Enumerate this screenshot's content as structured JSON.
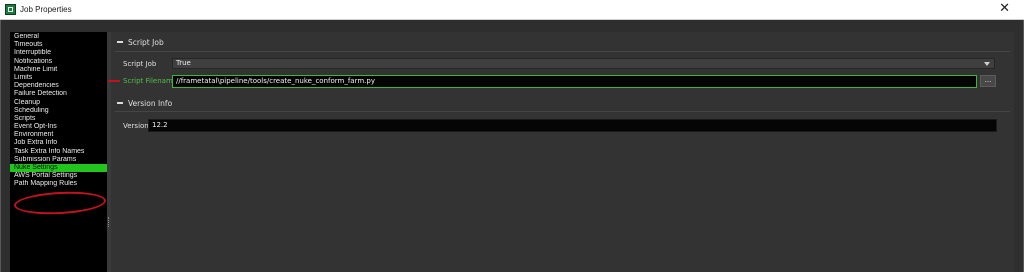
{
  "window": {
    "title": "Job Properties",
    "close_glyph": "✕"
  },
  "sidebar": {
    "items": [
      "General",
      "Timeouts",
      "Interruptible",
      "Notifications",
      "Machine Limit",
      "Limits",
      "Dependencies",
      "Failure Detection",
      "Cleanup",
      "Scheduling",
      "Scripts",
      "Event Opt-Ins",
      "Environment",
      "Job Extra Info",
      "Task Extra Info Names",
      "Submission Params",
      "Nuke Settings",
      "AWS Portal Settings",
      "Path Mapping Rules"
    ],
    "selected": "Nuke Settings"
  },
  "script_job_section": {
    "header": "Script Job",
    "script_job_label": "Script Job",
    "script_job_value": "True",
    "script_filename_label": "Script Filename",
    "script_filename_value": "//frametatal\\pipeline/tools/create_nuke_conform_farm.py",
    "browse_label": "..."
  },
  "version_section": {
    "header": "Version Info",
    "version_label": "Version",
    "version_value": "12.2"
  },
  "colors": {
    "selection": "#22c51b",
    "annotation": "#c1121f",
    "highlight_label": "#4fbf4a"
  }
}
